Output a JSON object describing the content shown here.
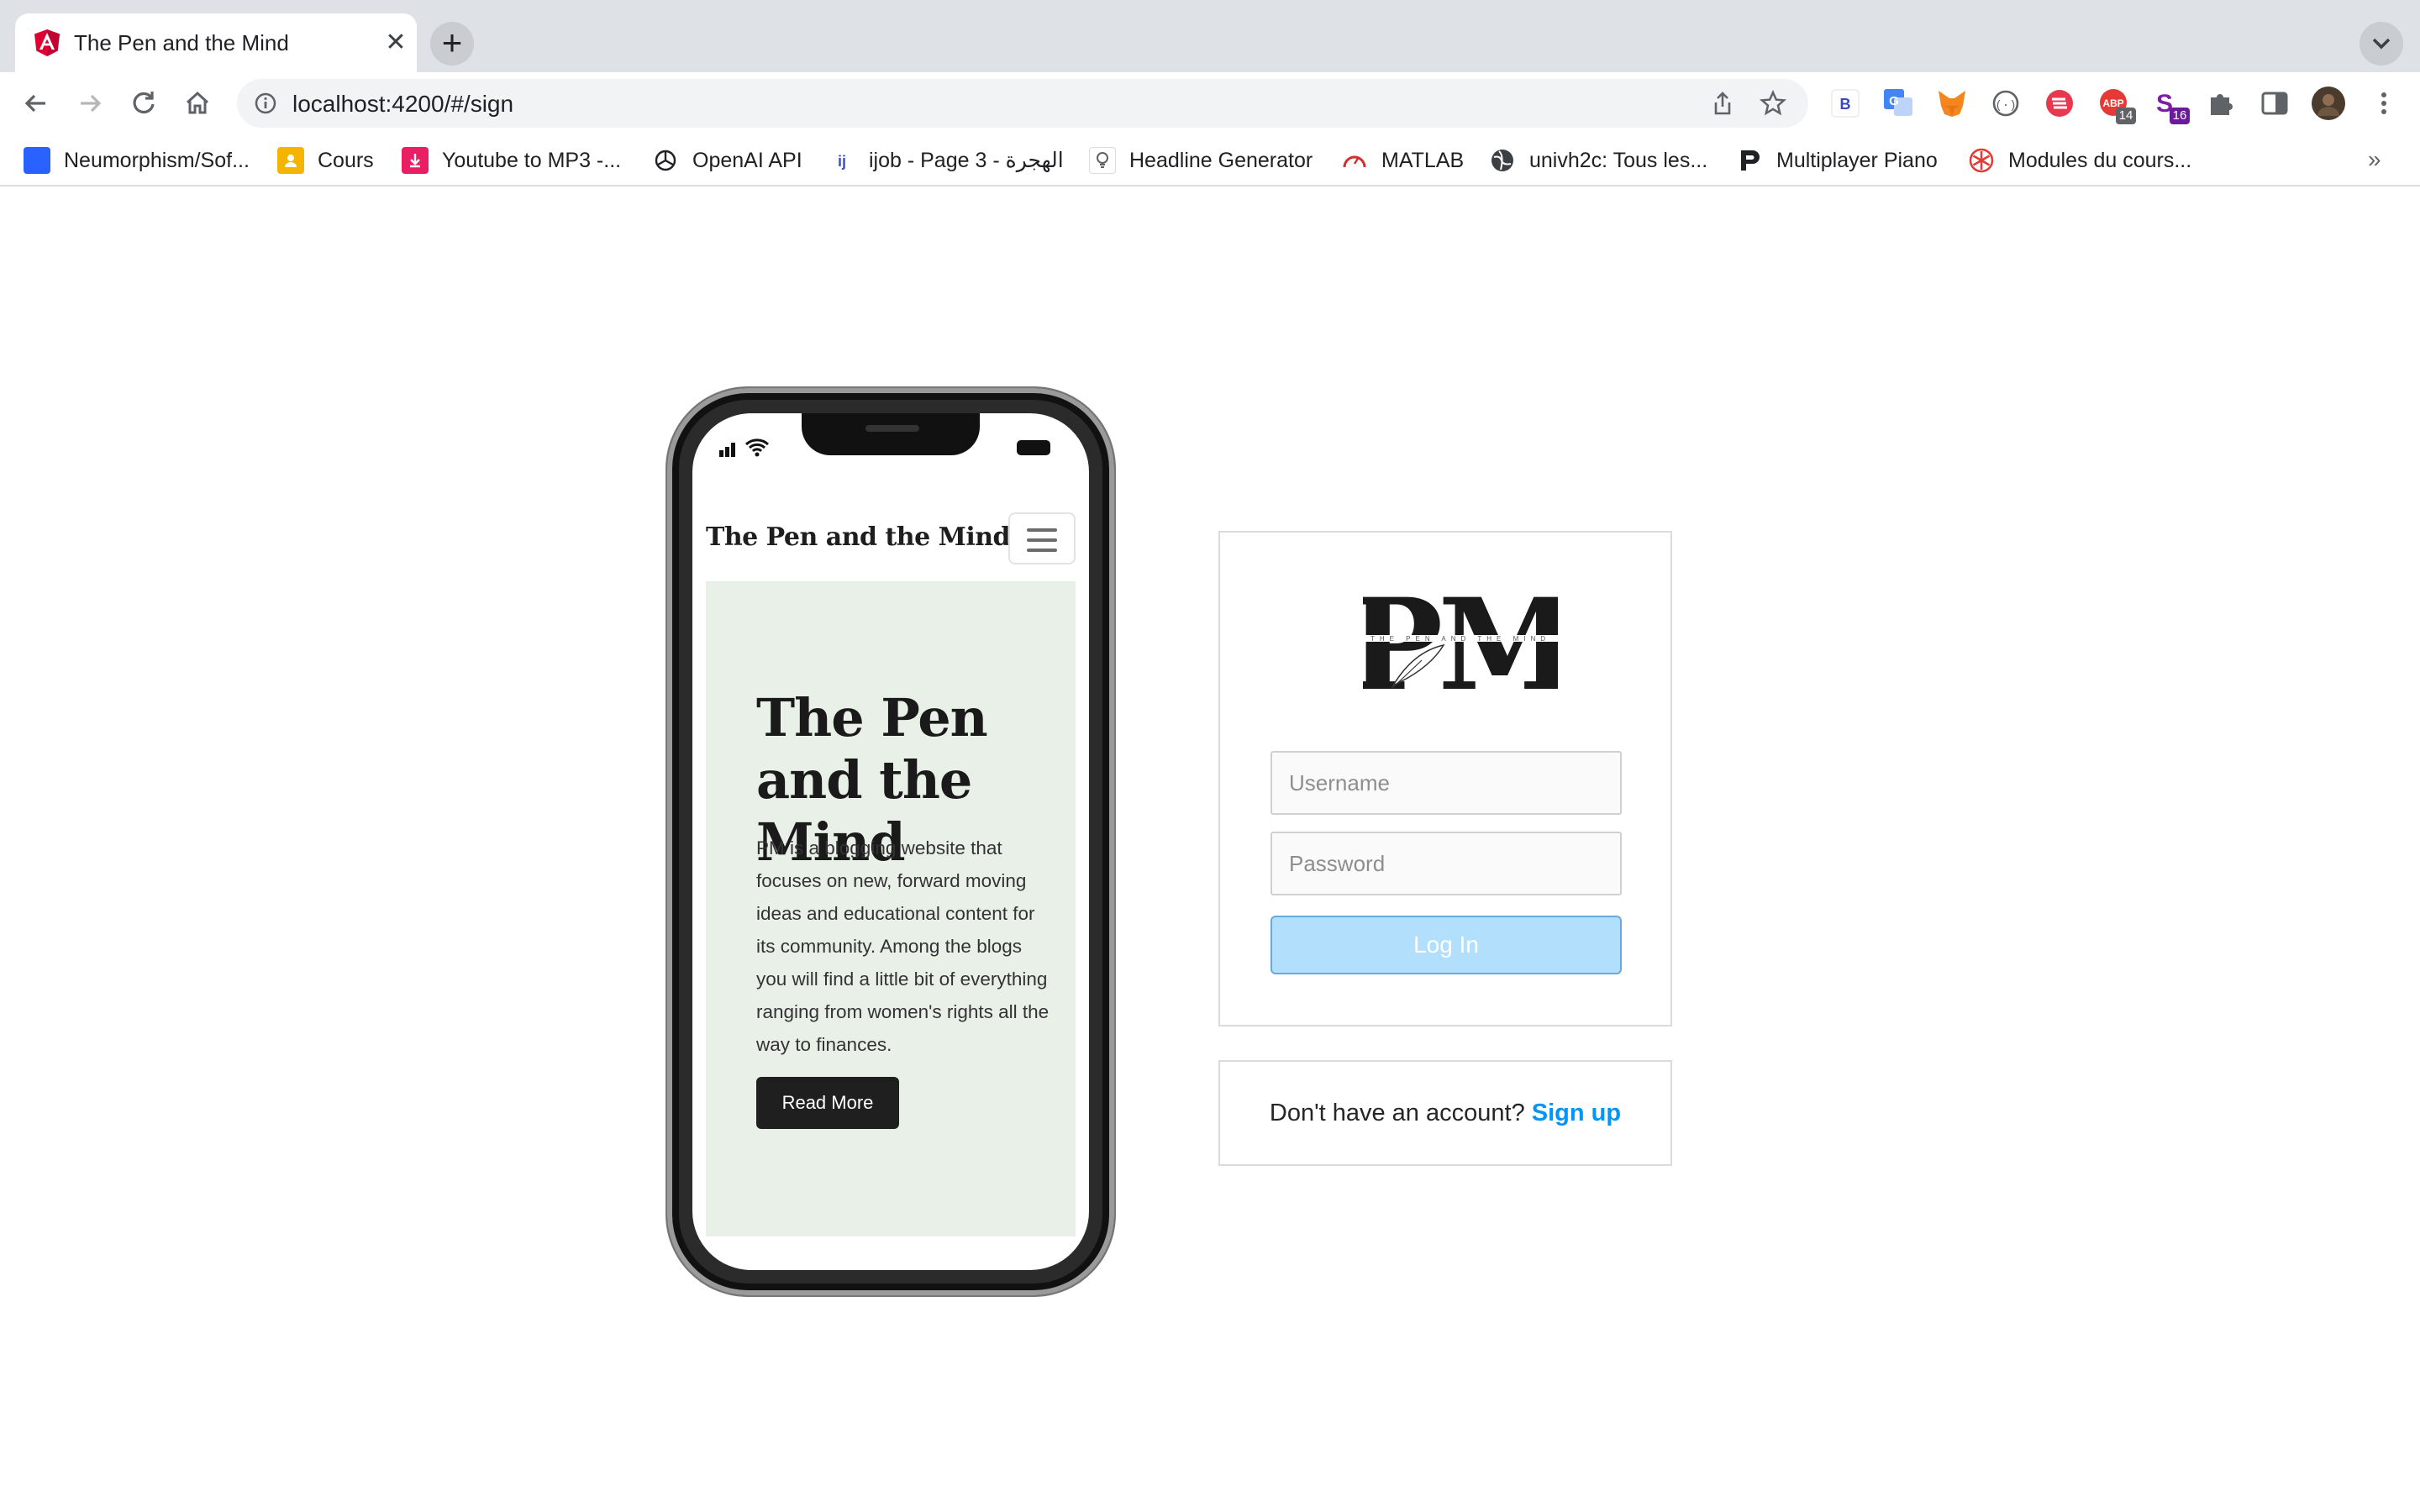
{
  "browser": {
    "tab_title": "The Pen and the Mind",
    "tab_close": "✕",
    "new_tab": "+",
    "url": "localhost:4200/#/sign",
    "bookmarks_more": "»"
  },
  "bookmarks": [
    {
      "label": "Neumorphism/Sof...",
      "icon": "neumorphism-icon",
      "color": "#2962ff"
    },
    {
      "label": "Cours",
      "icon": "google-classroom-icon",
      "color": "#f4b400"
    },
    {
      "label": "Youtube to MP3 -...",
      "icon": "download-icon",
      "color": "#e91e63"
    },
    {
      "label": "OpenAI API",
      "icon": "openai-icon",
      "color": "#202124"
    },
    {
      "label": "ijob - Page 3 - الهجرة",
      "icon": "ijob-icon",
      "color": "#3f51b5"
    },
    {
      "label": "Headline Generator",
      "icon": "lightbulb-icon",
      "color": "#5f6368"
    },
    {
      "label": "MATLAB",
      "icon": "gauge-icon",
      "color": "#d32f2f"
    },
    {
      "label": "univh2c: Tous les...",
      "icon": "globe-icon",
      "color": "#3c4043"
    },
    {
      "label": "Multiplayer Piano",
      "icon": "piano-icon",
      "color": "#202124"
    },
    {
      "label": "Modules du cours...",
      "icon": "snowflake-icon",
      "color": "#e53935"
    }
  ],
  "extensions": [
    {
      "name": "b-extension-icon",
      "badge": ""
    },
    {
      "name": "google-translate-icon",
      "badge": ""
    },
    {
      "name": "metamask-icon",
      "badge": ""
    },
    {
      "name": "code-extension-icon",
      "badge": ""
    },
    {
      "name": "stack-extension-icon",
      "badge": ""
    },
    {
      "name": "adblock-icon",
      "badge": "14"
    },
    {
      "name": "s-extension-icon",
      "badge": "16"
    },
    {
      "name": "puzzle-icon",
      "badge": ""
    },
    {
      "name": "sidepanel-icon",
      "badge": ""
    },
    {
      "name": "profile-avatar",
      "badge": ""
    },
    {
      "name": "kebab-menu-icon",
      "badge": ""
    }
  ],
  "phone_preview": {
    "brand": "The Pen and the Mind",
    "hero_title": "The Pen and the Mind",
    "hero_text": "PM is a blogging website that focuses on new, forward moving ideas and educational content for its community. Among the blogs you will find a little bit of everything ranging from women's rights all the way to finances.",
    "hero_button": "Read More"
  },
  "login": {
    "logo_text": "PM",
    "logo_tagline": "THE PEN AND THE MIND",
    "username_placeholder": "Username",
    "password_placeholder": "Password",
    "button": "Log In",
    "button_color": "#b2dffc"
  },
  "signup": {
    "prompt": "Don't have an account?",
    "link": "Sign up",
    "link_color": "#0095f6"
  }
}
